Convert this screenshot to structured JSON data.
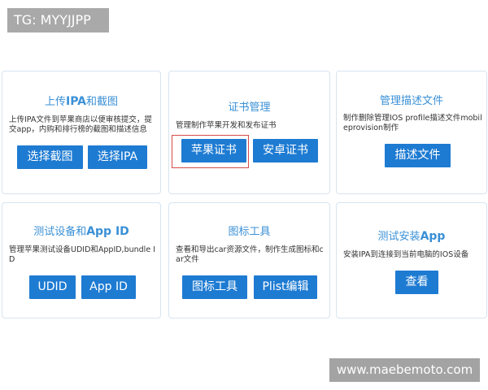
{
  "watermark_top": "TG: MYYJJPP",
  "watermark_bottom": "www.maebemoto.com",
  "cards": [
    {
      "title_prefix": "上传",
      "title_strong": "IPA",
      "title_suffix": "和截图",
      "desc": "上传IPA文件到苹果商店以便审核提交，提交app，内购和排行榜的截图和描述信息",
      "buttons": [
        "选择截图",
        "选择IPA"
      ]
    },
    {
      "title_prefix": "证书管理",
      "title_strong": "",
      "title_suffix": "",
      "desc": "管理制作苹果开发和发布证书",
      "buttons": [
        "苹果证书",
        "安卓证书"
      ]
    },
    {
      "title_prefix": "管理描述文件",
      "title_strong": "",
      "title_suffix": "",
      "desc": "制作删除管理IOS profile描述文件mobileprovision制作",
      "buttons": [
        "描述文件"
      ]
    },
    {
      "title_prefix": "测试设备和",
      "title_strong": "App ID",
      "title_suffix": "",
      "desc": "管理苹果测试设备UDID和AppID,bundle ID",
      "buttons": [
        "UDID",
        "App ID"
      ]
    },
    {
      "title_prefix": "图标工具",
      "title_strong": "",
      "title_suffix": "",
      "desc": "查看和导出car资源文件，制作生成图标和car文件",
      "buttons": [
        "图标工具",
        "Plist编辑"
      ]
    },
    {
      "title_prefix": "测试安装",
      "title_strong": "App",
      "title_suffix": "",
      "desc": "安装IPA到连接到当前电脑的IOS设备",
      "buttons": [
        "查看"
      ]
    }
  ],
  "colors": {
    "accent": "#1e7bd2",
    "title": "#3a90d6",
    "card_border": "#d7e4f0",
    "selection": "#d84a4a",
    "watermark": "#a9a9a9"
  }
}
